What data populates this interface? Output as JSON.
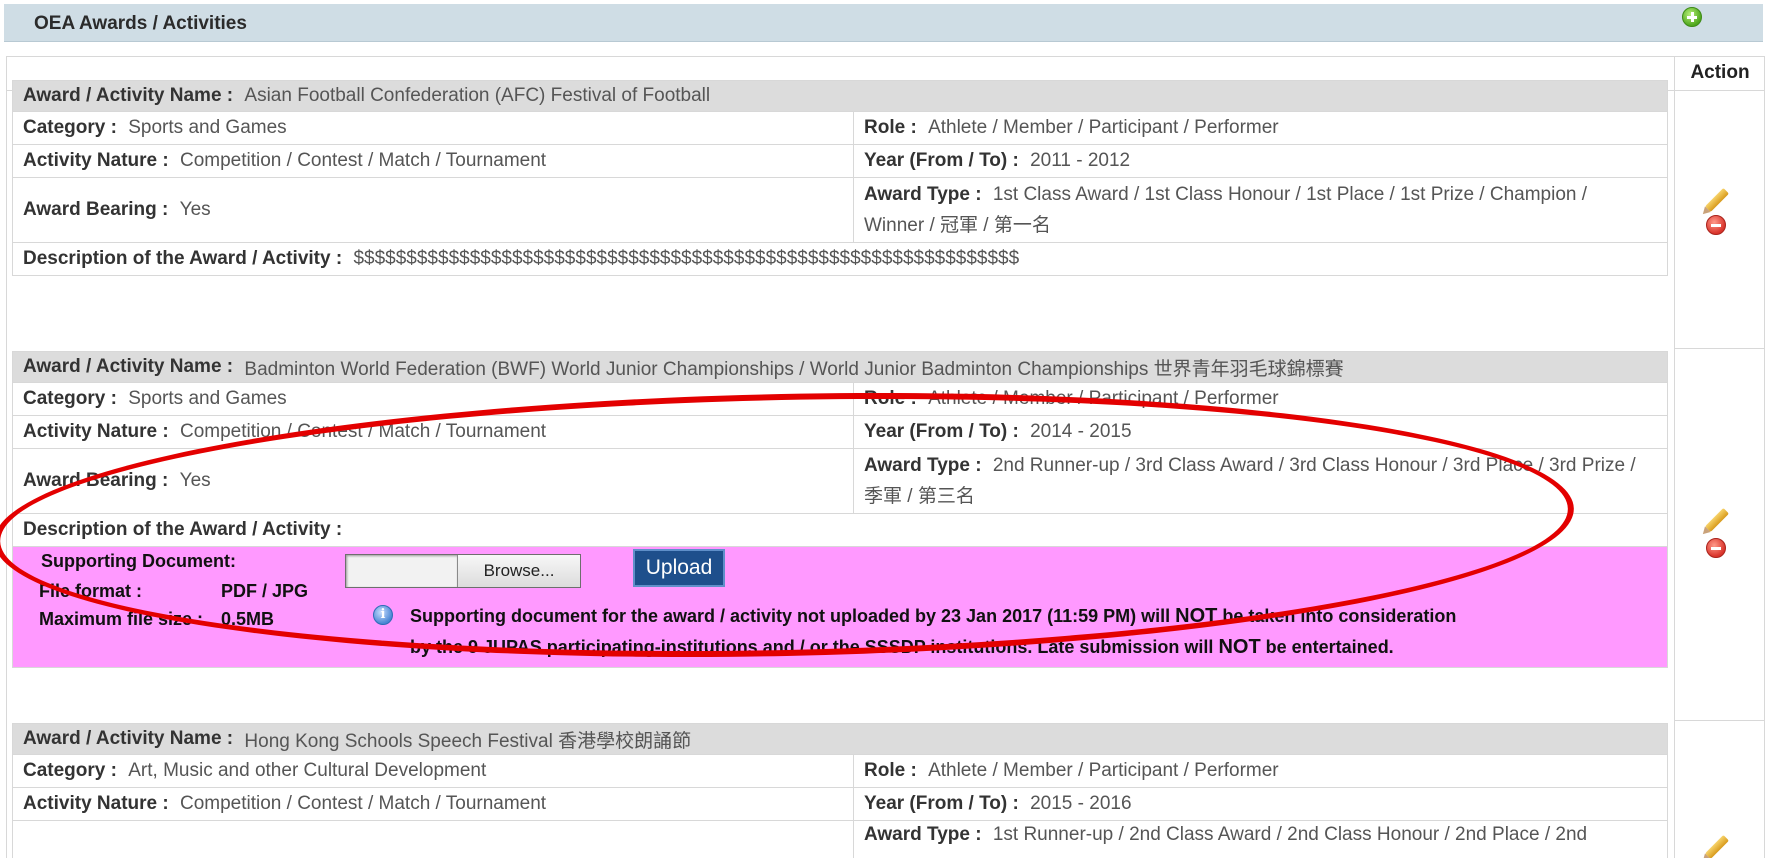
{
  "header": {
    "title": "OEA Awards / Activities",
    "add_icon": "add-circle-icon"
  },
  "table": {
    "action_header": "Action"
  },
  "labels": {
    "name": "Award / Activity Name : ",
    "category": "Category : ",
    "role": "Role : ",
    "nature": "Activity Nature : ",
    "year": "Year (From / To) : ",
    "bearing": "Award Bearing : ",
    "type": "Award Type : ",
    "description": "Description of the Award / Activity : "
  },
  "records": [
    {
      "name": "Asian Football Confederation (AFC) Festival of Football",
      "category": "Sports and Games",
      "role": "Athlete / Member / Participant / Performer",
      "nature": "Competition / Contest / Match / Tournament",
      "year": "2011 - 2012",
      "bearing": "Yes",
      "type": "1st Class Award / 1st Class Honour / 1st Place / 1st Prize / Champion / Winner / 冠軍 / 第一名",
      "description": "$$$$$$$$$$$$$$$$$$$$$$$$$$$$$$$$$$$$$$$$$$$$$$$$$$$$$$$$$$$$$$$"
    },
    {
      "name": "Badminton World Federation (BWF) World Junior Championships / World Junior Badminton Championships 世界青年羽毛球錦標賽",
      "category": "Sports and Games",
      "role": "Athlete / Member / Participant / Performer",
      "nature": "Competition / Contest / Match / Tournament",
      "year": "2014 - 2015",
      "bearing": "Yes",
      "type": "2nd Runner-up / 3rd Class Award / 3rd Class Honour / 3rd Place / 3rd Prize / 季軍 / 第三名",
      "description": ""
    },
    {
      "name": "Hong Kong Schools Speech Festival 香港學校朗誦節",
      "category": "Art, Music and other Cultural Development",
      "role": "Athlete / Member / Participant / Performer",
      "nature": "Competition / Contest / Match / Tournament",
      "year": "2015 - 2016",
      "type": "1st Runner-up / 2nd Class Award / 2nd Class Honour / 2nd Place / 2nd"
    }
  ],
  "upload": {
    "supporting_doc_label": "Supporting Document:",
    "file_format_label": "File format :",
    "file_format_value": "PDF / JPG",
    "max_size_label": "Maximum file size :",
    "max_size_value": "0.5MB",
    "browse_label": "Browse...",
    "upload_label": "Upload",
    "notice_line1_a": "Supporting document for the award / activity not uploaded by 23 Jan 2017 (11:59 PM) will ",
    "notice_not": "NOT",
    "notice_line1_b": " be taken into consideration",
    "notice_line2_a": "by the 9 JUPAS participating-institutions and / or the SSSDP institutions. Late submission will ",
    "notice_line2_b": " be entertained."
  },
  "icons": {
    "edit": "pencil-icon",
    "delete": "delete-icon",
    "info": "info-icon"
  },
  "colors": {
    "header_bg": "#cfdde5",
    "upload_panel_bg": "#ff99ff",
    "upload_button": "#1e4f8c",
    "highlight_ellipse": "#e30000"
  }
}
